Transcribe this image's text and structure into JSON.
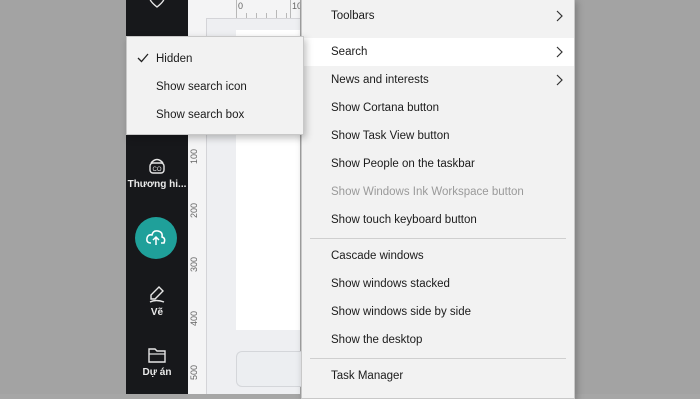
{
  "sidebar": {
    "items": [
      {
        "label": "Thương hi...",
        "icon": "brand-icon"
      },
      {
        "label": "Vẽ",
        "icon": "draw-icon"
      },
      {
        "label": "Dự án",
        "icon": "folder-icon"
      }
    ],
    "upload_icon": "cloud-upload-icon",
    "top_icon": "heart-icon"
  },
  "ruler": {
    "top_labels": [
      "0",
      "10"
    ],
    "left_labels": [
      "100",
      "200",
      "300",
      "400",
      "500"
    ]
  },
  "context_menu": {
    "items": [
      {
        "label": "Toolbars",
        "submenu": true
      },
      {
        "label": "Search",
        "submenu": true,
        "highlighted": true
      },
      {
        "label": "News and interests",
        "submenu": true
      },
      {
        "label": "Show Cortana button"
      },
      {
        "label": "Show Task View button"
      },
      {
        "label": "Show People on the taskbar"
      },
      {
        "label": "Show Windows Ink Workspace button",
        "disabled": true
      },
      {
        "label": "Show touch keyboard button"
      },
      {
        "label": "Cascade windows"
      },
      {
        "label": "Show windows stacked"
      },
      {
        "label": "Show windows side by side"
      },
      {
        "label": "Show the desktop"
      },
      {
        "label": "Task Manager"
      }
    ]
  },
  "search_submenu": {
    "items": [
      {
        "label": "Hidden",
        "checked": true
      },
      {
        "label": "Show search icon"
      },
      {
        "label": "Show search box"
      }
    ]
  },
  "colors": {
    "accent": "#1fa09a",
    "sidebar_bg": "#17181b",
    "menu_bg": "#f2f2f2",
    "menu_highlight": "#ffffff"
  }
}
